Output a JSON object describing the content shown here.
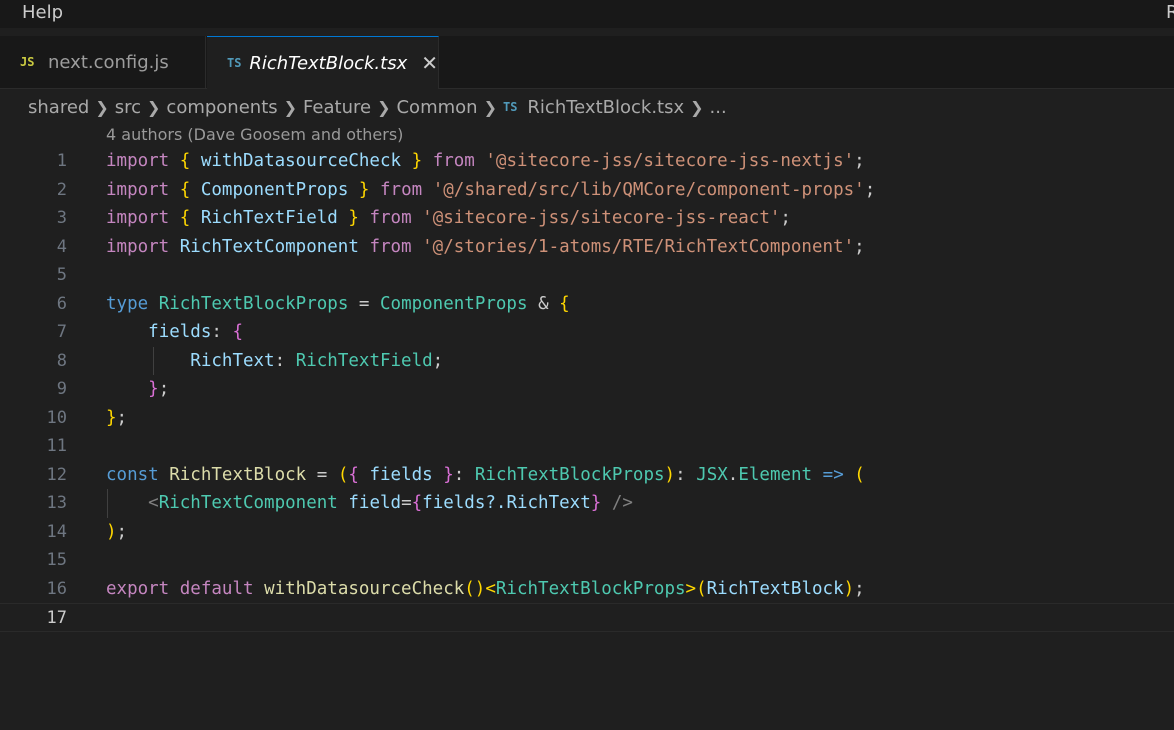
{
  "menubar": {
    "help": "Help",
    "right_letter": "R"
  },
  "tabs": [
    {
      "icon": "JS",
      "label": "next.config.js",
      "active": false
    },
    {
      "icon": "TS",
      "label": "RichTextBlock.tsx",
      "active": true,
      "close": "✕"
    }
  ],
  "breadcrumb": {
    "items": [
      "shared",
      "src",
      "components",
      "Feature",
      "Common"
    ],
    "file_icon": "TS",
    "file": "RichTextBlock.tsx",
    "ellipsis": "..."
  },
  "codelens": "4 authors (Dave Goosem and others)",
  "line_numbers": [
    "1",
    "2",
    "3",
    "4",
    "5",
    "6",
    "7",
    "8",
    "9",
    "10",
    "11",
    "12",
    "13",
    "14",
    "15",
    "16",
    "17"
  ],
  "code": {
    "l1": {
      "import": "import",
      "b_open": "{",
      "name": "withDatasourceCheck",
      "b_close": "}",
      "from": "from",
      "path": "'@sitecore-jss/sitecore-jss-nextjs'",
      "semi": ";"
    },
    "l2": {
      "import": "import",
      "b_open": "{",
      "name": "ComponentProps",
      "b_close": "}",
      "from": "from",
      "path": "'@/shared/src/lib/QMCore/component-props'",
      "semi": ";"
    },
    "l3": {
      "import": "import",
      "b_open": "{",
      "name": "RichTextField",
      "b_close": "}",
      "from": "from",
      "path": "'@sitecore-jss/sitecore-jss-react'",
      "semi": ";"
    },
    "l4": {
      "import": "import",
      "name": "RichTextComponent",
      "from": "from",
      "path": "'@/stories/1-atoms/RTE/RichTextComponent'",
      "semi": ";"
    },
    "l6": {
      "type": "type",
      "name": "RichTextBlockProps",
      "eq": "=",
      "base": "ComponentProps",
      "amp": "&",
      "b_open": "{"
    },
    "l7": {
      "prop": "fields",
      "colon": ":",
      "b_open": "{"
    },
    "l8": {
      "prop": "RichText",
      "colon": ":",
      "ty": "RichTextField",
      "semi": ";"
    },
    "l9": {
      "b_close": "}",
      "semi": ";"
    },
    "l10": {
      "b_close": "}",
      "semi": ";"
    },
    "l12": {
      "const": "const",
      "name": "RichTextBlock",
      "eq": "=",
      "p_open": "(",
      "c_open": "{",
      "param": "fields",
      "c_close": "}",
      "colon": ":",
      "ptype": "RichTextBlockProps",
      "p_close": ")",
      "colon2": ":",
      "jsx": "JSX",
      "dot": ".",
      "el": "Element",
      "arrow": "=>",
      "p2_open": "("
    },
    "l13": {
      "lt": "<",
      "comp": "RichTextComponent",
      "attr": "field",
      "eq": "=",
      "c_open": "{",
      "expr": "fields?.RichText",
      "c_close": "}",
      "end": " />"
    },
    "l14": {
      "p_close": ")",
      "semi": ";"
    },
    "l16": {
      "export": "export",
      "default": "default",
      "fn": "withDatasourceCheck",
      "call": "()",
      "lt": "<",
      "ty": "RichTextBlockProps",
      "gt": ">",
      "p_open": "(",
      "arg": "RichTextBlock",
      "p_close": ")",
      "semi": ";"
    }
  }
}
